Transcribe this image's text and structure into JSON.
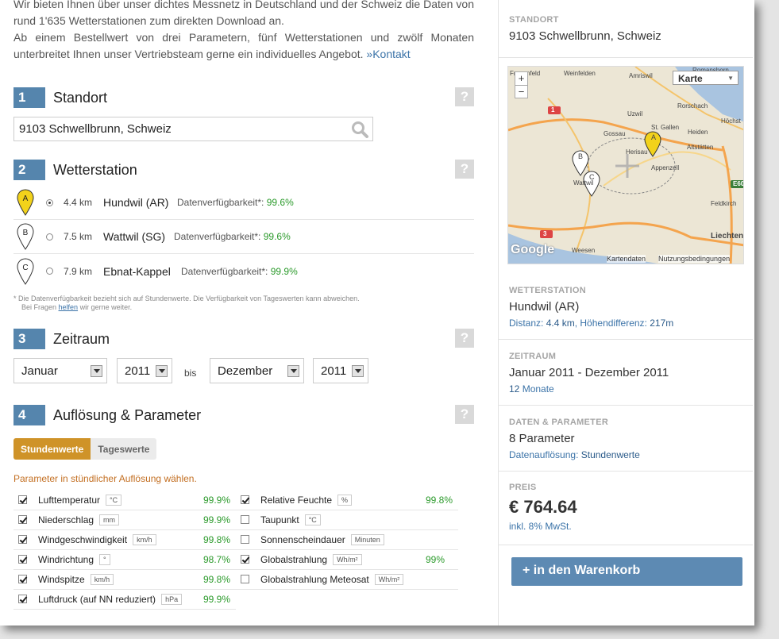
{
  "intro": {
    "line1": "Wir bieten Ihnen über unser dichtes Messnetz in Deutschland und der Schweiz die Daten von rund 1'635 Wetterstationen zum direkten Download an.",
    "line2": "Ab einem Bestellwert von drei Parametern, fünf Wetterstationen und zwölf Monaten unterbreitet Ihnen unser Vertriebsteam gerne ein individuelles Angebot.",
    "contact_link": "»Kontakt"
  },
  "sections": {
    "s1": {
      "num": "1",
      "title": "Standort"
    },
    "s2": {
      "num": "2",
      "title": "Wetterstation"
    },
    "s3": {
      "num": "3",
      "title": "Zeitraum"
    },
    "s4": {
      "num": "4",
      "title": "Auflösung & Parameter"
    },
    "help": "?"
  },
  "location": {
    "value": "9103 Schwellbrunn, Schweiz"
  },
  "stations": [
    {
      "marker": "A",
      "distance": "4.4 km",
      "name": "Hundwil (AR)",
      "avail_label": "Datenverfügbarkeit*:",
      "avail": "99.6%",
      "selected": true
    },
    {
      "marker": "B",
      "distance": "7.5 km",
      "name": "Wattwil (SG)",
      "avail_label": "Datenverfügbarkeit*:",
      "avail": "99.6%",
      "selected": false
    },
    {
      "marker": "C",
      "distance": "7.9 km",
      "name": "Ebnat-Kappel",
      "avail_label": "Datenverfügbarkeit*:",
      "avail": "99.9%",
      "selected": false
    }
  ],
  "footnote": {
    "line1": "* Die Datenverfügbarkeit bezieht sich auf Stundenwerte. Die Verfügbarkeit von Tageswerten kann abweichen.",
    "line2_pre": "Bei Fragen ",
    "line2_link": "helfen",
    "line2_post": " wir gerne weiter."
  },
  "period": {
    "from_month": "Januar",
    "from_year": "2011",
    "to_label": "bis",
    "to_month": "Dezember",
    "to_year": "2011"
  },
  "resolution": {
    "hourly": "Stundenwerte",
    "daily": "Tageswerte",
    "hint": "Parameter in stündlicher Auflösung wählen."
  },
  "params_left": [
    {
      "label": "Lufttemperatur",
      "unit": "°C",
      "pct": "99.9%",
      "checked": true
    },
    {
      "label": "Niederschlag",
      "unit": "mm",
      "pct": "99.9%",
      "checked": true
    },
    {
      "label": "Windgeschwindigkeit",
      "unit": "km/h",
      "pct": "99.8%",
      "checked": true
    },
    {
      "label": "Windrichtung",
      "unit": "°",
      "pct": "98.7%",
      "checked": true
    },
    {
      "label": "Windspitze",
      "unit": "km/h",
      "pct": "99.8%",
      "checked": true
    },
    {
      "label": "Luftdruck (auf NN reduziert)",
      "unit": "hPa",
      "pct": "99.9%",
      "checked": true
    }
  ],
  "params_right": [
    {
      "label": "Relative Feuchte",
      "unit": "%",
      "pct": "99.8%",
      "checked": true
    },
    {
      "label": "Taupunkt",
      "unit": "°C",
      "pct": "",
      "checked": false
    },
    {
      "label": "Sonnenscheindauer",
      "unit": "Minuten",
      "pct": "",
      "checked": false
    },
    {
      "label": "Globalstrahlung",
      "unit": "Wh/m²",
      "pct": "99%",
      "checked": true
    },
    {
      "label": "Globalstrahlung Meteosat",
      "unit": "Wh/m²",
      "pct": "",
      "checked": false
    }
  ],
  "summary": {
    "standort_label": "STANDORT",
    "standort_value": "9103 Schwellbrunn, Schweiz",
    "map": {
      "type_select": "Karte",
      "labels": [
        "Frauenfeld",
        "Weinfelden",
        "Amriswil",
        "Romanshorn",
        "Uzwil",
        "Gossau",
        "St. Gallen",
        "Herisau",
        "Appenzell",
        "Altstätten",
        "Rorschach",
        "Heiden",
        "Höchst",
        "Feldkirch",
        "Liechtenstein",
        "Weesen",
        "Wattwil"
      ],
      "road_badges": [
        "1",
        "3",
        "E60"
      ],
      "footer_terms": "Kartendaten",
      "footer_usage": "Nutzungsbedingungen",
      "google": "Google"
    },
    "station_label": "WETTERSTATION",
    "station_value": "Hundwil (AR)",
    "station_dist_label": "Distanz:",
    "station_dist": "4.4 km",
    "station_alt_label": "Höhendifferenz:",
    "station_alt": "217m",
    "period_label": "ZEITRAUM",
    "period_value": "Januar 2011 - Dezember 2011",
    "period_months_num": "12",
    "period_months_word": "Monate",
    "params_label": "DATEN & PARAMETER",
    "params_value": "8 Parameter",
    "params_res_label": "Datenauflösung:",
    "params_res": "Stundenwerte",
    "price_label": "PREIS",
    "price_value": "€ 764.64",
    "price_tax": "inkl. 8% MwSt.",
    "cart_button": "+ in den Warenkorb"
  },
  "colors": {
    "accent": "#5585ad",
    "toggle_active": "#cf9328",
    "availability": "#2b9a2b",
    "link": "#3b73a8"
  }
}
